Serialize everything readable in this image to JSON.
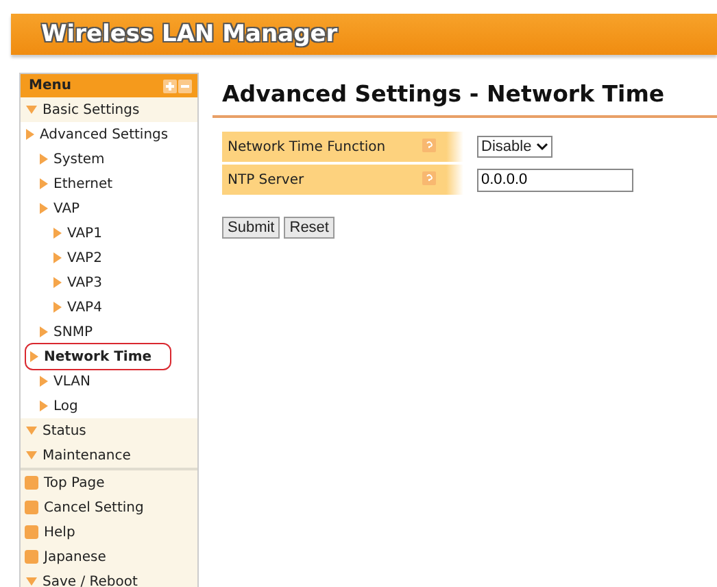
{
  "header": {
    "title": "Wireless LAN Manager"
  },
  "menu": {
    "title": "Menu",
    "sections": [
      {
        "kind": "section",
        "label": "Basic Settings",
        "expanded": true
      },
      {
        "kind": "section",
        "label": "Advanced Settings",
        "expanded": false,
        "children": [
          {
            "label": "System",
            "selected": false
          },
          {
            "label": "Ethernet",
            "selected": false
          },
          {
            "label": "VAP",
            "selected": false,
            "children": [
              {
                "label": "VAP1",
                "selected": false
              },
              {
                "label": "VAP2",
                "selected": false
              },
              {
                "label": "VAP3",
                "selected": false
              },
              {
                "label": "VAP4",
                "selected": false
              }
            ]
          },
          {
            "label": "SNMP",
            "selected": false
          },
          {
            "label": "Network Time",
            "selected": true
          },
          {
            "label": "VLAN",
            "selected": false
          },
          {
            "label": "Log",
            "selected": false
          }
        ]
      },
      {
        "kind": "section",
        "label": "Status",
        "expanded": true
      },
      {
        "kind": "section",
        "label": "Maintenance",
        "expanded": true
      },
      {
        "kind": "link",
        "label": "Top Page"
      },
      {
        "kind": "link",
        "label": "Cancel Setting"
      },
      {
        "kind": "link",
        "label": "Help"
      },
      {
        "kind": "link",
        "label": "Japanese"
      },
      {
        "kind": "section",
        "label": "Save / Reboot",
        "expanded": true
      }
    ]
  },
  "page": {
    "title": "Advanced Settings - Network Time",
    "fields": [
      {
        "kind": "select",
        "label": "Network Time Function",
        "value": "Disable"
      },
      {
        "kind": "text",
        "label": "NTP Server",
        "value": "0.0.0.0"
      }
    ],
    "buttons": [
      "Submit",
      "Reset"
    ]
  }
}
